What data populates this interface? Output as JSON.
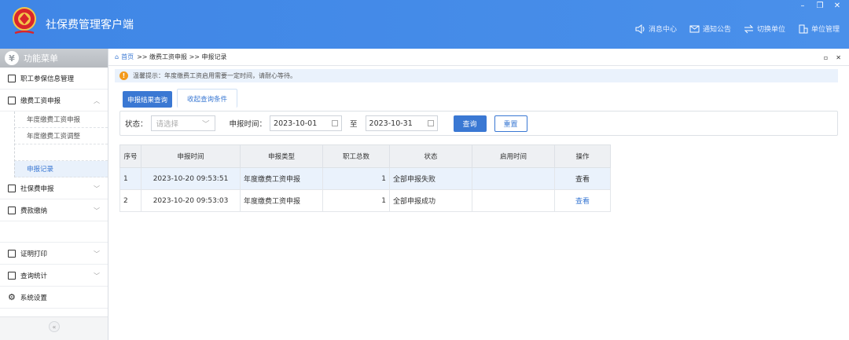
{
  "header": {
    "title": "社保费管理客户端",
    "nav": [
      {
        "label": "消息中心",
        "icon": "speaker-icon"
      },
      {
        "label": "通知公告",
        "icon": "mail-icon"
      },
      {
        "label": "切换单位",
        "icon": "switch-icon"
      },
      {
        "label": "单位管理",
        "icon": "building-icon"
      }
    ]
  },
  "sidebar": {
    "title": "功能菜单",
    "items": [
      {
        "label": "职工参保信息管理"
      },
      {
        "label": "缴费工资申报"
      },
      {
        "label": "社保费申报"
      },
      {
        "label": "费款缴纳"
      },
      {
        "label": "证明打印"
      },
      {
        "label": "查询统计"
      },
      {
        "label": "系统设置"
      }
    ],
    "subitems": [
      {
        "label": "年度缴费工资申报"
      },
      {
        "label": "年度缴费工资调整"
      },
      {
        "label": "申报记录"
      }
    ]
  },
  "breadcrumb": {
    "home": "首页",
    "path": ">> 缴费工资申报 >> 申报记录"
  },
  "tip": "温馨提示：年度缴费工资启用需要一定时间，请耐心等待。",
  "tabs": {
    "result": "申报结果查询",
    "collapse": "收起查询条件"
  },
  "filter": {
    "status_label": "状态：",
    "status_placeholder": "请选择",
    "time_label": "申报时间：",
    "start_date": "2023-10-01",
    "to_label": "至",
    "end_date": "2023-10-31",
    "query_btn": "查询",
    "reset_btn": "重置"
  },
  "table": {
    "headers": [
      "序号",
      "申报时间",
      "申报类型",
      "职工总数",
      "状态",
      "启用时间",
      "操作"
    ],
    "rows": [
      {
        "no": "1",
        "time": "2023-10-20 09:53:51",
        "type": "年度缴费工资申报",
        "count": "1",
        "status": "全部申报失败",
        "enable": "",
        "action": "查看"
      },
      {
        "no": "2",
        "time": "2023-10-20 09:53:03",
        "type": "年度缴费工资申报",
        "count": "1",
        "status": "全部申报成功",
        "enable": "",
        "action": "查看"
      }
    ]
  }
}
